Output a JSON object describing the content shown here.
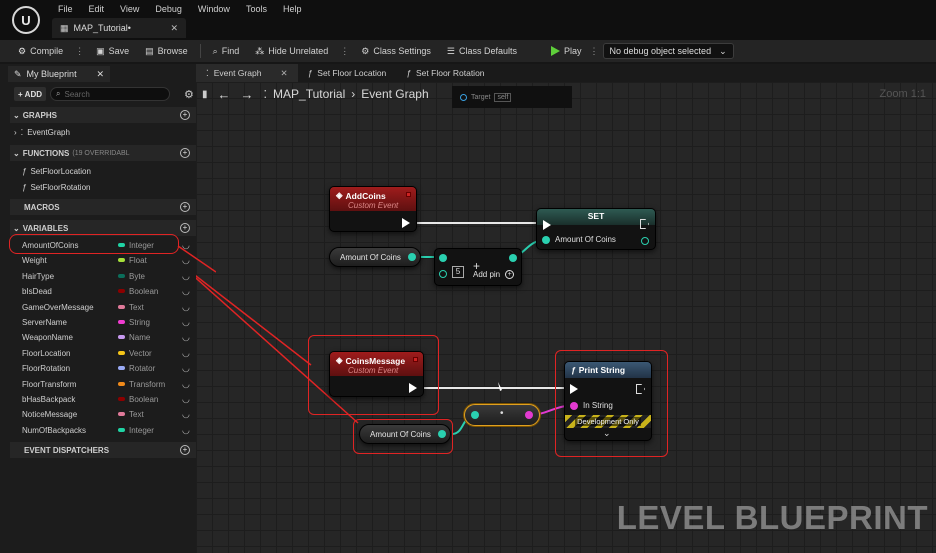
{
  "menu": {
    "logo": "U",
    "items": [
      "File",
      "Edit",
      "View",
      "Debug",
      "Window",
      "Tools",
      "Help"
    ],
    "doc_tab": "MAP_Tutorial•"
  },
  "toolbar": {
    "compile": "Compile",
    "save": "Save",
    "browse": "Browse",
    "find": "Find",
    "hide_unrelated": "Hide Unrelated",
    "class_settings": "Class Settings",
    "class_defaults": "Class Defaults",
    "play": "Play",
    "debug_object": "No debug object selected"
  },
  "left_panel": {
    "tab": "My Blueprint",
    "add": "ADD",
    "search_placeholder": "Search",
    "graphs_header": "GRAPHS",
    "event_graph": "EventGraph",
    "functions_header": "FUNCTIONS",
    "functions_sub": "(19 OVERRIDABL",
    "functions": [
      "SetFloorLocation",
      "SetFloorRotation"
    ],
    "macros_header": "MACROS",
    "variables_header": "VARIABLES",
    "variables": [
      {
        "name": "AmountOfCoins",
        "type": "Integer",
        "color": "#1fd3a4"
      },
      {
        "name": "Weight",
        "type": "Float",
        "color": "#a6e03a"
      },
      {
        "name": "HairType",
        "type": "Byte",
        "color": "#0b6e5b"
      },
      {
        "name": "bIsDead",
        "type": "Boolean",
        "color": "#8c0000"
      },
      {
        "name": "GameOverMessage",
        "type": "Text",
        "color": "#e07a9a"
      },
      {
        "name": "ServerName",
        "type": "String",
        "color": "#f03cd0"
      },
      {
        "name": "WeaponName",
        "type": "Name",
        "color": "#c89af0"
      },
      {
        "name": "FloorLocation",
        "type": "Vector",
        "color": "#f5c518"
      },
      {
        "name": "FloorRotation",
        "type": "Rotator",
        "color": "#9aaaf5"
      },
      {
        "name": "FloorTransform",
        "type": "Transform",
        "color": "#f08a1a"
      },
      {
        "name": "bHasBackpack",
        "type": "Boolean",
        "color": "#8c0000"
      },
      {
        "name": "NoticeMessage",
        "type": "Text",
        "color": "#e07a9a"
      },
      {
        "name": "NumOfBackpacks",
        "type": "Integer",
        "color": "#1fd3a4"
      }
    ],
    "dispatchers_header": "EVENT DISPATCHERS"
  },
  "graph_tabs": [
    "Event Graph",
    "Set Floor Location",
    "Set Floor Rotation"
  ],
  "graph": {
    "breadcrumb_root": "MAP_Tutorial",
    "breadcrumb_leaf": "Event Graph",
    "zoom": "Zoom 1:1",
    "target_label": "Target",
    "target_value": "self",
    "watermark": "LEVEL BLUEPRINT"
  },
  "nodes": {
    "add_coins": {
      "title": "AddCoins",
      "sub": "Custom Event"
    },
    "set": {
      "title": "SET",
      "pin": "Amount Of Coins"
    },
    "amount_get_1": "Amount Of Coins",
    "add": {
      "value": "5",
      "add_pin": "Add pin"
    },
    "coins_message": {
      "title": "CoinsMessage",
      "sub": "Custom Event"
    },
    "amount_get_2": "Amount Of Coins",
    "print_string": {
      "title": "Print String",
      "in_pin": "In String",
      "dev": "Development Only"
    }
  }
}
